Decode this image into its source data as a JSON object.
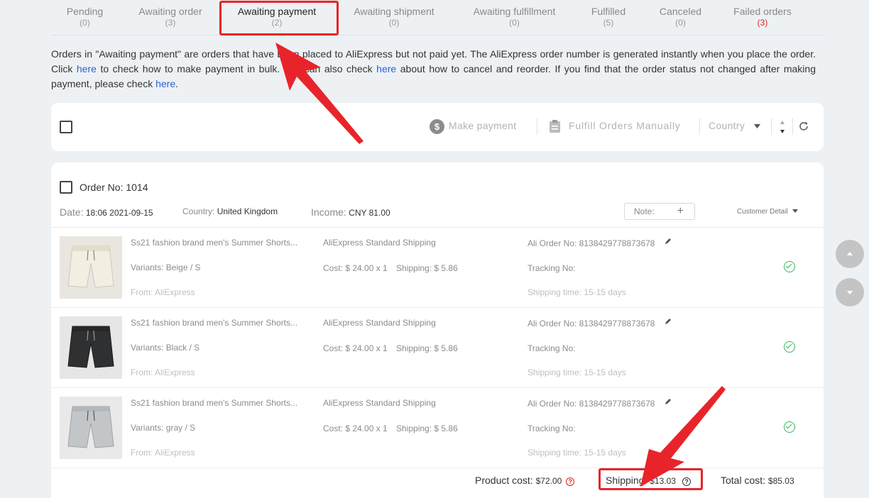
{
  "tabs": [
    {
      "label": "Pending",
      "count": "(0)"
    },
    {
      "label": "Awaiting order",
      "count": "(3)"
    },
    {
      "label": "Awaiting payment",
      "count": "(2)"
    },
    {
      "label": "Awaiting shipment",
      "count": "(0)"
    },
    {
      "label": "Awaiting fulfillment",
      "count": "(0)"
    },
    {
      "label": "Fulfilled",
      "count": "(5)"
    },
    {
      "label": "Canceled",
      "count": "(0)"
    },
    {
      "label": "Failed orders",
      "count": "(3)"
    }
  ],
  "intro": {
    "p1": "Orders in \"Awaiting payment\" are orders that have been placed to AliExpress but not paid yet. The AliExpress order number is generated instantly when you place the order. Click ",
    "link1": "here",
    "p2": " to check how to make payment in bulk. You can also check ",
    "link2": "here",
    "p3": " about how to cancel and reorder. If you find that the order status not changed after making payment, please check ",
    "link3": "here",
    "p4": "."
  },
  "toolbar": {
    "make_payment": "Make payment",
    "fulfill_manually": "Fulfill Orders Manually",
    "country": "Country"
  },
  "order": {
    "title": "Order No: 1014",
    "date_label": "Date:",
    "date": "18:06 2021-09-15",
    "country_label": "Country:",
    "country": "United Kingdom",
    "income_label": "Income:",
    "income": "CNY 81.00",
    "note_label": "Note:",
    "customer_detail": "Customer Detail",
    "items": [
      {
        "title": "Ss21 fashion brand men's Summer Shorts...",
        "variant": "Variants: Beige / S",
        "from": "From: AliExpress",
        "shipping_method": "AliExpress Standard Shipping",
        "cost": "Cost: $ 24.00 x 1",
        "shipping": "Shipping: $ 5.86",
        "ali_order": "Ali Order No: 8138429778873678",
        "tracking": "Tracking No:",
        "ship_time": "Shipping time: 15-15 days",
        "color": "#f1ede1"
      },
      {
        "title": "Ss21 fashion brand men's Summer Shorts...",
        "variant": "Variants: Black / S",
        "from": "From: AliExpress",
        "shipping_method": "AliExpress Standard Shipping",
        "cost": "Cost: $ 24.00 x 1",
        "shipping": "Shipping: $ 5.86",
        "ali_order": "Ali Order No: 8138429778873678",
        "tracking": "Tracking No:",
        "ship_time": "Shipping time: 15-15 days",
        "color": "#2f3031"
      },
      {
        "title": "Ss21 fashion brand men's Summer Shorts...",
        "variant": "Variants: gray / S",
        "from": "From: AliExpress",
        "shipping_method": "AliExpress Standard Shipping",
        "cost": "Cost: $ 24.00 x 1",
        "shipping": "Shipping: $ 5.86",
        "ali_order": "Ali Order No: 8138429778873678",
        "tracking": "Tracking No:",
        "ship_time": "Shipping time: 15-15 days",
        "color": "#c3c6c9"
      }
    ],
    "product_cost_label": "Product cost:",
    "product_cost": "$72.00",
    "shipping_label": "Shipping:",
    "shipping_total": "$13.03",
    "total_label": "Total cost:",
    "total": "$85.03"
  },
  "colors": {
    "accent_red": "#e8242a",
    "link": "#2962d9",
    "success": "#3ab45b"
  }
}
